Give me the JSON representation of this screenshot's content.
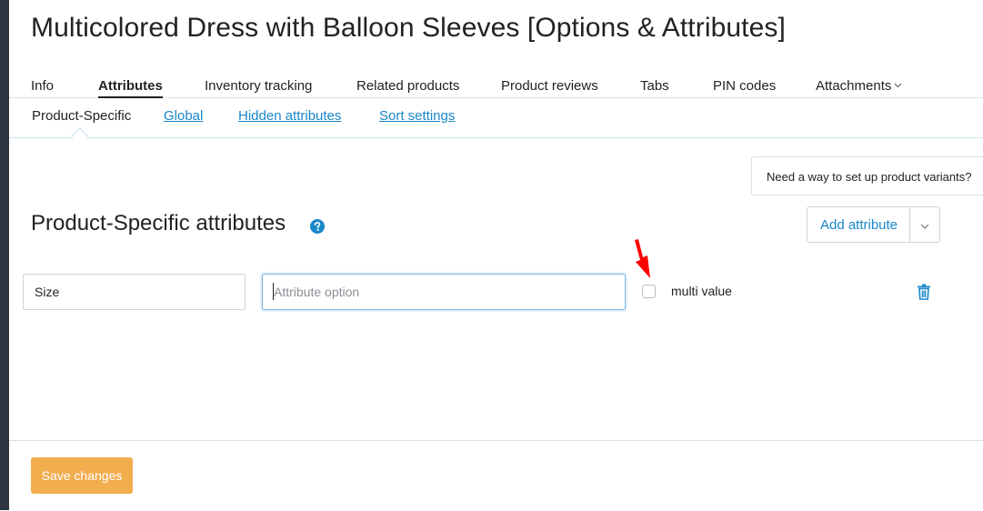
{
  "page": {
    "title": "Multicolored Dress with Balloon Sleeves [Options & Attributes]"
  },
  "tabs": [
    {
      "label": "Info",
      "active": false
    },
    {
      "label": "Attributes",
      "active": true
    },
    {
      "label": "Inventory tracking",
      "active": false
    },
    {
      "label": "Related products",
      "active": false
    },
    {
      "label": "Product reviews",
      "active": false
    },
    {
      "label": "Tabs",
      "active": false
    },
    {
      "label": "PIN codes",
      "active": false
    },
    {
      "label": "Attachments",
      "active": false,
      "dropdown": true
    }
  ],
  "subtabs": [
    {
      "label": "Product-Specific",
      "active": true
    },
    {
      "label": "Global",
      "active": false
    },
    {
      "label": "Hidden attributes",
      "active": false
    },
    {
      "label": "Sort settings",
      "active": false
    }
  ],
  "hint": {
    "text": "Need a way to set up product variants?"
  },
  "section": {
    "title": "Product-Specific attributes",
    "help_icon": "question-circle-icon",
    "add_button_label": "Add attribute",
    "caret_icon": "chevron-down-icon"
  },
  "attribute_row": {
    "name_value": "Size",
    "option_value": "",
    "option_placeholder": "Attribute option",
    "multi_value_checked": false,
    "multi_value_label": "multi value",
    "delete_icon": "trash-icon"
  },
  "annotation": {
    "icon": "red-arrow-icon",
    "color": "#ff0000"
  },
  "footer": {
    "save_label": "Save changes"
  },
  "colors": {
    "link": "#1a87c9",
    "save_button": "#f2ad4e",
    "left_strip": "#2e3440"
  }
}
